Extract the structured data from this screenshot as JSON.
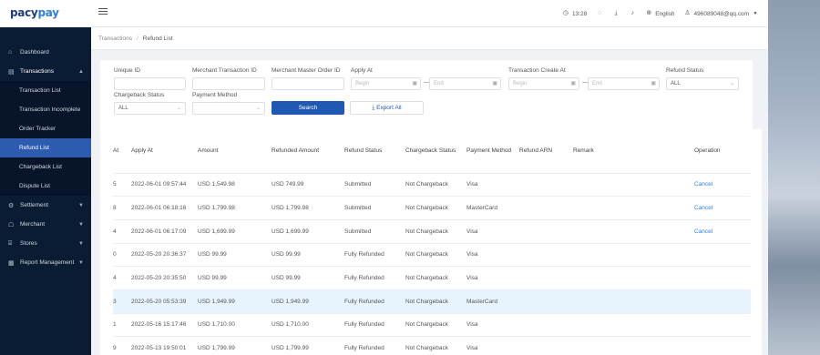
{
  "brand": {
    "logo_main": "pacy",
    "logo_accent": "pay"
  },
  "topbar": {
    "time": "13:28",
    "language": "English",
    "user": "496089048@qq.com"
  },
  "sidebar": {
    "items": [
      {
        "label": "Dashboard",
        "icon": "home-icon"
      },
      {
        "label": "Transactions",
        "icon": "document-icon",
        "expanded": true,
        "children": [
          {
            "label": "Transaction List"
          },
          {
            "label": "Transaction Incomplete"
          },
          {
            "label": "Order Tracker"
          },
          {
            "label": "Refund List",
            "active": true
          },
          {
            "label": "Chargeback List"
          },
          {
            "label": "Dispute List"
          }
        ]
      },
      {
        "label": "Settlement",
        "icon": "settings-icon"
      },
      {
        "label": "Merchant",
        "icon": "merchant-icon"
      },
      {
        "label": "Stores",
        "icon": "store-icon"
      },
      {
        "label": "Report Management",
        "icon": "report-icon"
      }
    ]
  },
  "breadcrumb": {
    "parent": "Transactions",
    "current": "Refund List"
  },
  "filters": {
    "unique_id": {
      "label": "Unique ID",
      "value": ""
    },
    "merchant_tx_id": {
      "label": "Merchant Transaction ID",
      "value": ""
    },
    "merchant_master_order_id": {
      "label": "Merchant Master Order ID",
      "value": ""
    },
    "apply_at": {
      "label": "Apply At",
      "begin_ph": "Begin",
      "end_ph": "End"
    },
    "tx_create_at": {
      "label": "Transaction Create At",
      "begin_ph": "Begin",
      "end_ph": "End"
    },
    "refund_status": {
      "label": "Refund Status",
      "value": "ALL"
    },
    "chargeback_status": {
      "label": "Chargeback Status",
      "value": "ALL"
    },
    "payment_method": {
      "label": "Payment Method",
      "value": ""
    },
    "search_label": "Search",
    "export_label": "Export All"
  },
  "table": {
    "headers": [
      "At",
      "Apply At",
      "Amount",
      "Refunded Amount",
      "Refund Status",
      "Chargeback Status",
      "Payment Method",
      "Refund ARN",
      "Remark",
      "Operation"
    ],
    "rows": [
      [
        "5",
        "2022-06-01 09:57:44",
        "USD 1,549.98",
        "USD 749.99",
        "Submitted",
        "Not Chargeback",
        "Visa",
        "",
        "",
        "Cancel"
      ],
      [
        "8",
        "2022-06-01 06:18:16",
        "USD 1,799.98",
        "USD 1,799.98",
        "Submitted",
        "Not Chargeback",
        "MasterCard",
        "",
        "",
        "Cancel"
      ],
      [
        "4",
        "2022-06-01 06:17:09",
        "USD 1,699.99",
        "USD 1,699.99",
        "Submitted",
        "Not Chargeback",
        "Visa",
        "",
        "",
        "Cancel"
      ],
      [
        "0",
        "2022-05-20 20:36:37",
        "USD 99.99",
        "USD 99.99",
        "Fully Refunded",
        "Not Chargeback",
        "Visa",
        "",
        "",
        ""
      ],
      [
        "4",
        "2022-05-20 20:35:50",
        "USD 99.99",
        "USD 99.99",
        "Fully Refunded",
        "Not Chargeback",
        "Visa",
        "",
        "",
        ""
      ],
      [
        "3",
        "2022-05-20 05:53:39",
        "USD 1,949.99",
        "USD 1,949.99",
        "Fully Refunded",
        "Not Chargeback",
        "MasterCard",
        "",
        "",
        ""
      ],
      [
        "1",
        "2022-05-16 15:17:46",
        "USD 1,710.00",
        "USD 1,710.00",
        "Fully Refunded",
        "Not Chargeback",
        "Visa",
        "",
        "",
        ""
      ],
      [
        "9",
        "2022-05-13 19:50:01",
        "USD 1,799.99",
        "USD 1,799.99",
        "Fully Refunded",
        "Not Chargeback",
        "Visa",
        "",
        "",
        ""
      ]
    ],
    "highlighted_row": 5
  },
  "colors": {
    "sidebar_bg": "#0a1c33",
    "active": "#2d5bb0",
    "primary": "#1f59b3",
    "link": "#2f7fd8"
  }
}
